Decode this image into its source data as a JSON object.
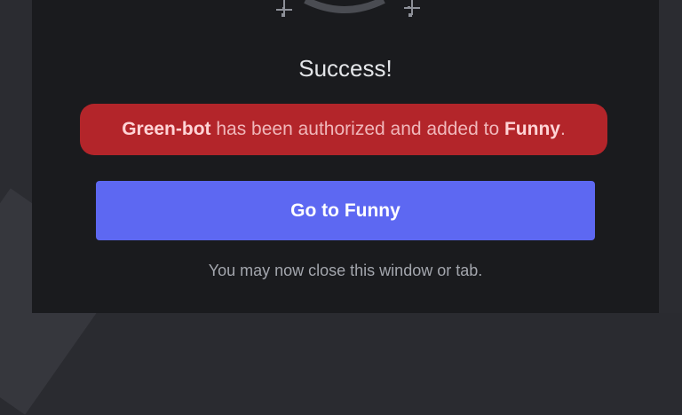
{
  "dialog": {
    "title": "Success!",
    "status": {
      "bot_name": "Green-bot",
      "middle_text": " has been authorized and added to ",
      "server_name": "Funny",
      "end_text": ".",
      "banner_color": "#b3252a"
    },
    "primary_button_label": "Go to Funny",
    "primary_button_color": "#5d68f2",
    "footer_hint": "You may now close this window or tab."
  }
}
